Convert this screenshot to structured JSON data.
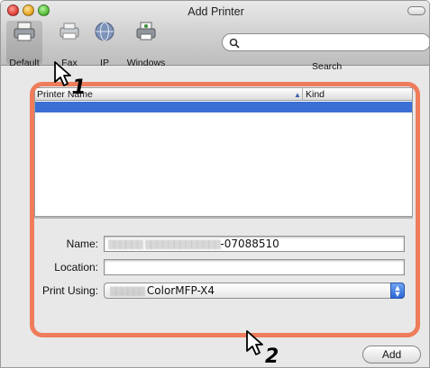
{
  "window": {
    "title": "Add Printer"
  },
  "toolbar": {
    "items": [
      {
        "label": "Default",
        "icon": "default-printer-icon",
        "selected": true
      },
      {
        "label": "Fax",
        "icon": "fax-icon",
        "selected": false
      },
      {
        "label": "IP",
        "icon": "ip-globe-icon",
        "selected": false
      },
      {
        "label": "Windows",
        "icon": "windows-printer-icon",
        "selected": false
      }
    ],
    "search": {
      "label": "Search",
      "value": ""
    }
  },
  "printer_list": {
    "columns": [
      {
        "label": "Printer Name"
      },
      {
        "label": "Kind",
        "sorted": "ascending"
      }
    ],
    "rows": [
      {
        "name": "",
        "kind": "",
        "selected": true
      }
    ]
  },
  "form": {
    "name_label": "Name:",
    "name_value_suffix": "-07088510",
    "location_label": "Location:",
    "location_value": "",
    "print_using_label": "Print Using:",
    "print_using_value": "ColorMFP-X4"
  },
  "actions": {
    "add_label": "Add"
  },
  "callouts": {
    "step1": "1",
    "step2": "2"
  },
  "colors": {
    "highlight_frame": "#ef7c5b",
    "selection": "#3b6fd6"
  }
}
